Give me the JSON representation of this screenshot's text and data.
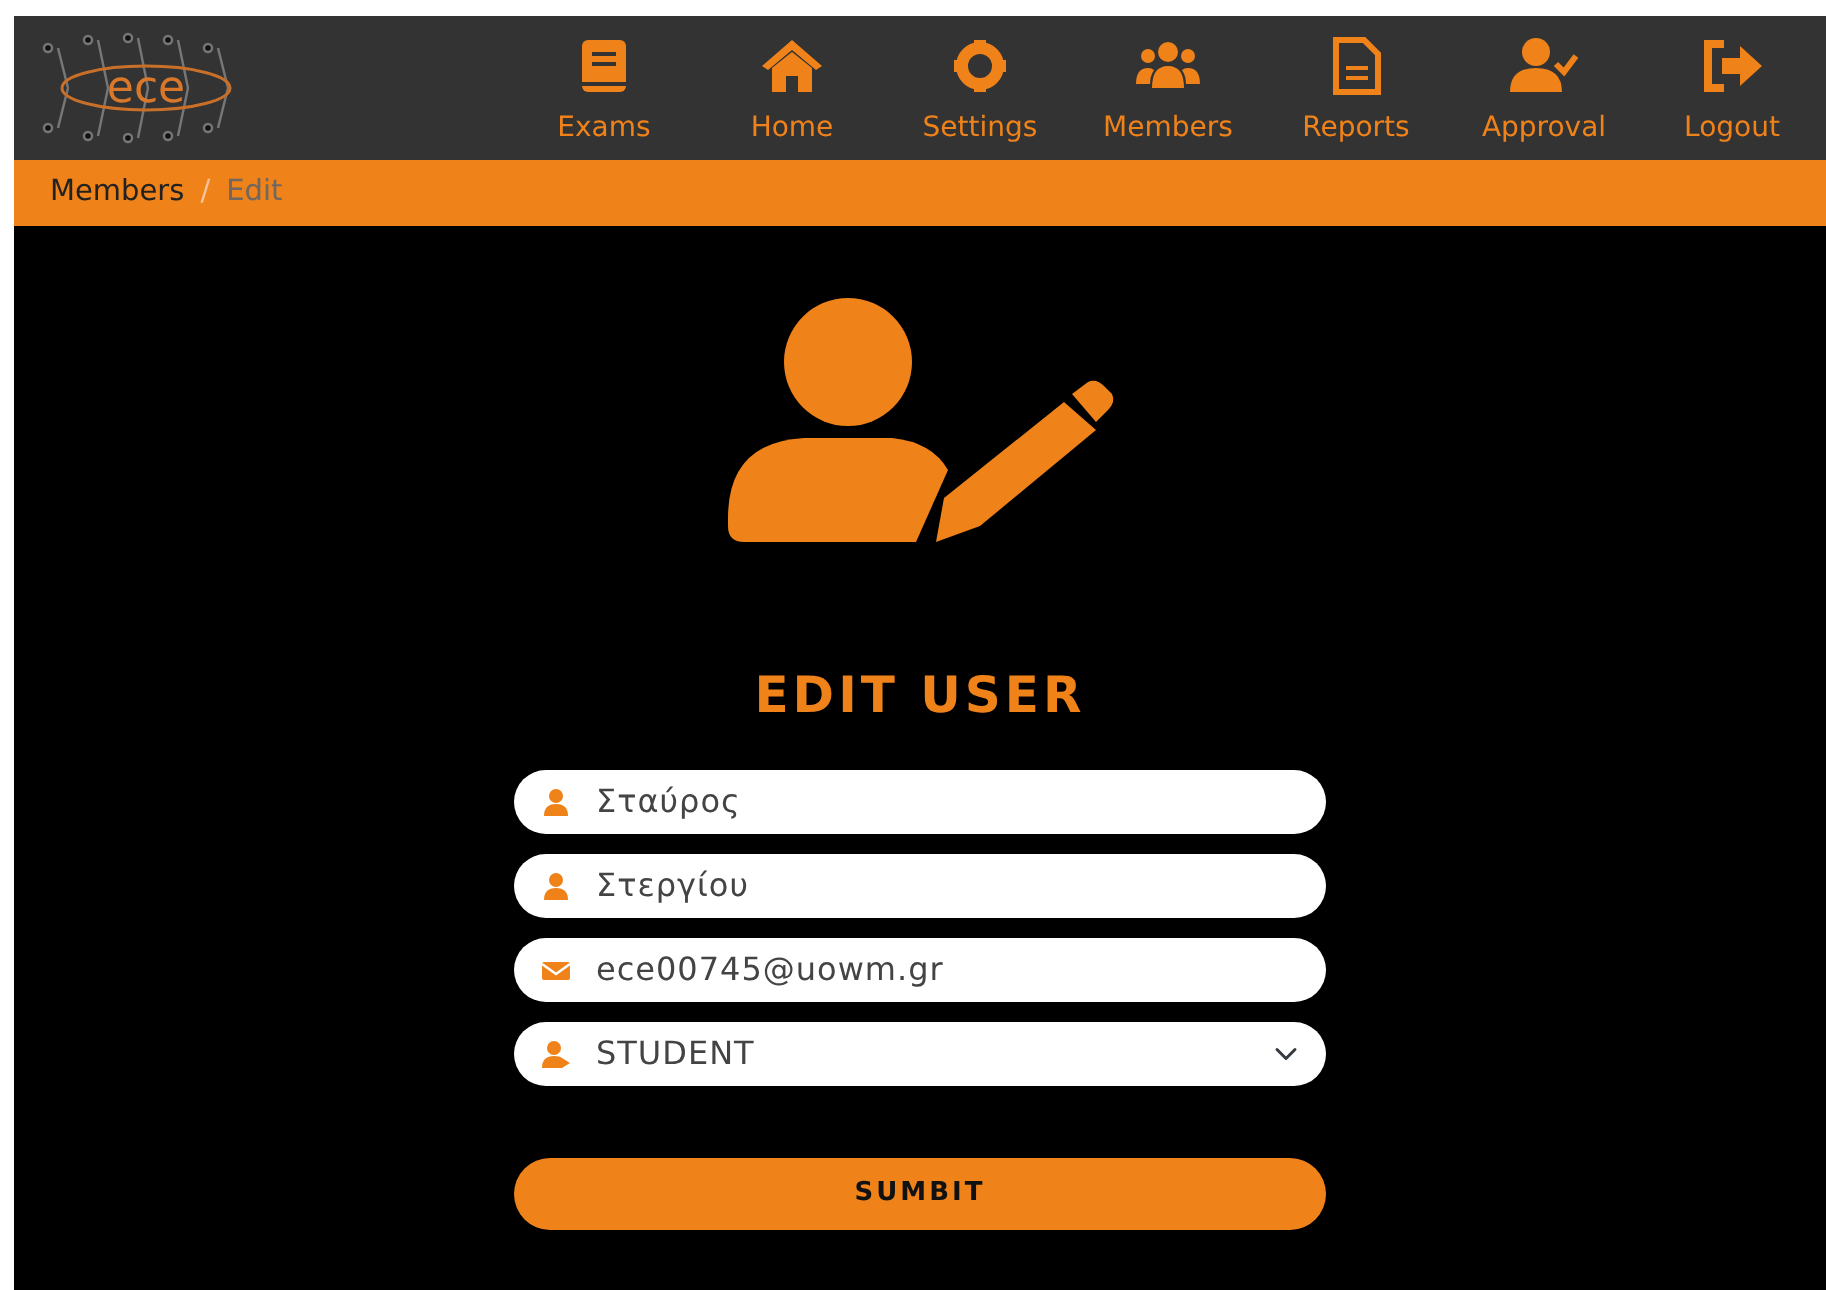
{
  "logo": {
    "text": "ece"
  },
  "nav": [
    {
      "label": "Exams",
      "kind": "book"
    },
    {
      "label": "Home",
      "kind": "home"
    },
    {
      "label": "Settings",
      "kind": "gear"
    },
    {
      "label": "Members",
      "kind": "users"
    },
    {
      "label": "Reports",
      "kind": "file"
    },
    {
      "label": "Approval",
      "kind": "usercheck"
    },
    {
      "label": "Logout",
      "kind": "logout"
    }
  ],
  "breadcrumb": [
    {
      "label": "Members",
      "active": false
    },
    {
      "label": "Edit",
      "active": true
    }
  ],
  "breadcrumb_separator": "/",
  "title": "EDIT USER",
  "fields": [
    {
      "kind": "name",
      "value": "Σταύρος"
    },
    {
      "kind": "name",
      "value": "Στεργίου"
    },
    {
      "kind": "email",
      "value": "ece00745@uowm.gr"
    },
    {
      "kind": "role",
      "value": "STUDENT"
    }
  ],
  "submit": "SUMBIT"
}
